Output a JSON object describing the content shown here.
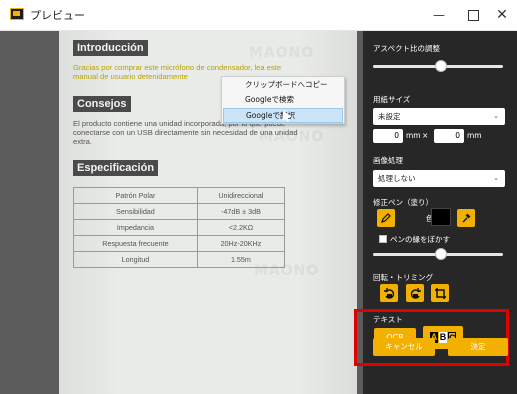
{
  "window": {
    "title": "プレビュー",
    "controls": {
      "minimize": "—",
      "maximize": "",
      "close": "✕"
    }
  },
  "document": {
    "watermark": "MAONO",
    "intro_heading": "Introducción",
    "intro_text": "Gracias por comprar este micrófono de condensador, lea este manual de usuario detenidamente",
    "tips_heading": "Consejos",
    "tips_text": "El producto contiene una unidad incorporada, por lo que puede conectarse con un USB directamente sin necesidad de una unidad extra.",
    "spec_heading": "Especificación",
    "spec_rows": [
      [
        "Patrón Polar",
        "Unidireccional"
      ],
      [
        "Sensibilidad",
        "-47dB ± 3dB"
      ],
      [
        "Impedancia",
        "<2.2KΩ"
      ],
      [
        "Respuesta frecuente",
        "20Hz-20KHz"
      ],
      [
        "Longitud",
        "1.55m"
      ]
    ]
  },
  "context_menu": {
    "items": [
      "クリップボードへコピー",
      "Googleで検索",
      "Googleで翻訳"
    ],
    "highlighted_index": 2
  },
  "panel": {
    "aspect_label": "アスペクト比の調整",
    "aspect_slider_value": 0.5,
    "paper_label": "用紙サイズ",
    "paper_value": "未設定",
    "width_value": "0",
    "height_value": "0",
    "unit_mm": "mm",
    "times": "×",
    "image_proc_label": "画像処理",
    "image_proc_value": "処理しない",
    "pen_label": "修正ペン（塗り）",
    "color_label": "色",
    "pen_color": "#000000",
    "blur_label": "ペンの縁をぼかす",
    "pen_slider_value": 0.5,
    "rotate_label": "回転・トリミング",
    "text_label": "テキスト",
    "ocr_label": "OCR",
    "abc": {
      "a": "A",
      "b": "B",
      "c": "C"
    },
    "cancel_label": "キャンセル",
    "ok_label": "決定"
  },
  "colors": {
    "accent": "#f2b100",
    "panel_bg": "#272727",
    "highlight_red": "#e00000"
  }
}
